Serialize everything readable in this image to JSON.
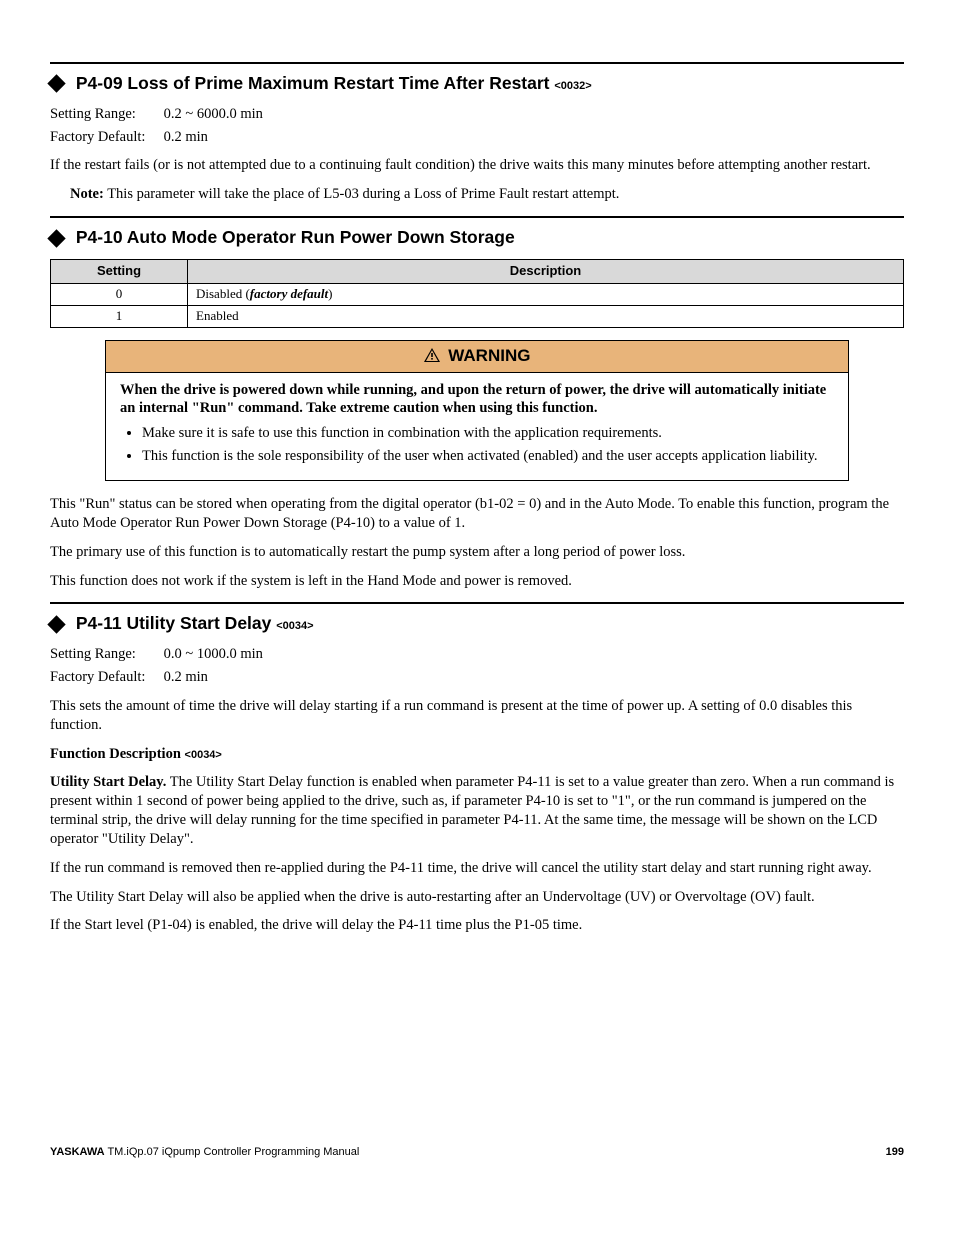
{
  "s1": {
    "title": "P4-09 Loss of Prime Maximum Restart Time After Restart ",
    "code": "<0032>",
    "setting_range_label": "Setting Range:",
    "setting_range_value": "0.2 ~ 6000.0 min",
    "factory_default_label": "Factory Default:",
    "factory_default_value": "0.2 min",
    "body": "If the restart fails (or is not attempted due to a continuing fault condition) the drive waits this many minutes before attempting another restart.",
    "note_label": "Note:",
    "note_text": "This parameter will take the place of L5-03 during a Loss of Prime Fault restart attempt."
  },
  "s2": {
    "title": "P4-10 Auto Mode Operator Run Power Down Storage",
    "table": {
      "col_setting": "Setting",
      "col_desc": "Description",
      "rows": [
        {
          "setting": "0",
          "desc_pre": "Disabled (",
          "desc_fd": "factory default",
          "desc_post": ")"
        },
        {
          "setting": "1",
          "desc_pre": "Enabled",
          "desc_fd": "",
          "desc_post": ""
        }
      ]
    },
    "warning": {
      "head": "WARNING",
      "lead": "When the drive is powered down while running, and upon the return of power, the drive will automatically initiate an internal \"Run\" command. Take extreme caution when using this function.",
      "bullets": [
        "Make sure it is safe to use this function in combination with the application requirements.",
        "This function is the sole responsibility of the user when activated (enabled) and the user accepts application liability."
      ]
    },
    "p1": "This \"Run\" status can be stored when operating from the digital operator (b1-02 = 0) and in the Auto Mode. To enable this function, program the Auto Mode Operator Run Power Down Storage (P4-10) to a value of 1.",
    "p2": "The primary use of this function is to automatically restart the pump system after a long period of power loss.",
    "p3": "This function does not work if the system is left in the Hand Mode and power is removed."
  },
  "s3": {
    "title": "P4-11 Utility Start Delay ",
    "code": "<0034>",
    "setting_range_label": "Setting Range:",
    "setting_range_value": "0.0 ~ 1000.0 min",
    "factory_default_label": "Factory Default:",
    "factory_default_value": "0.2 min",
    "body": "This sets the amount of time the drive will delay starting if a run command is present at the time of power up. A setting of 0.0 disables this function.",
    "fn_head_pre": "Function Description ",
    "fn_head_code": "<0034>",
    "usd_lead": "Utility Start Delay.",
    "usd_body": " The Utility Start Delay function is enabled when parameter P4-11 is set to a value greater than zero. When a run command is present within 1 second of power being applied to the drive, such as, if parameter P4-10 is set to \"1\", or the run command is jumpered on the terminal strip, the drive will delay running for the time specified in parameter P4-11. At the same time, the message will be shown on the LCD operator \"Utility Delay\".",
    "p2": "If the run command is removed then re-applied during the P4-11 time, the drive will cancel the utility start delay and start running right away.",
    "p3": "The Utility Start Delay will also be applied when the drive is auto-restarting after an Undervoltage (UV) or Overvoltage (OV) fault.",
    "p4": "If the Start level (P1-04) is enabled, the drive will delay the P4-11 time plus the P1-05 time."
  },
  "footer": {
    "brand": "YASKAWA",
    "doc": " TM.iQp.07 iQpump Controller Programming Manual",
    "page": "199"
  }
}
